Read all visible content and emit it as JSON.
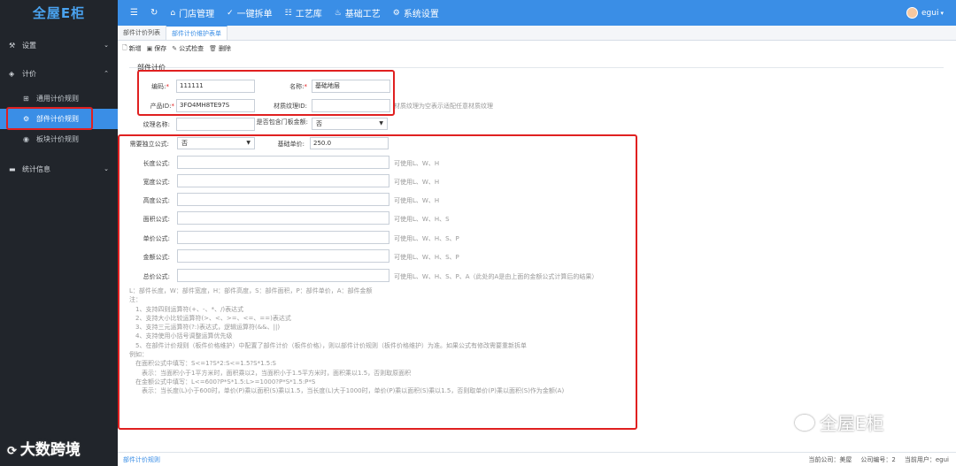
{
  "app": {
    "logo": "全屋E柜"
  },
  "sidebar": {
    "groups": [
      {
        "label": "设置",
        "icon": "settings-icon"
      },
      {
        "label": "计价",
        "icon": "diamond-icon"
      },
      {
        "label": "统计信息",
        "icon": "chart-icon"
      }
    ],
    "sub_items": [
      {
        "label": "通用计价规则"
      },
      {
        "label": "部件计价规则"
      },
      {
        "label": "板块计价规则"
      }
    ]
  },
  "topbar": {
    "menu_icon": "☰",
    "refresh_icon": "↻",
    "items": [
      "门店管理",
      "一键拆单",
      "工艺库",
      "基础工艺",
      "系统设置"
    ],
    "user": "egui"
  },
  "tabs": [
    "部件计价列表",
    "部件计价维护表单"
  ],
  "toolbar": {
    "new": "新增",
    "save": "保存",
    "check": "公式检查",
    "delete": "删除"
  },
  "form": {
    "legend": "部件计价",
    "code_label": "编码:",
    "code_value": "111111",
    "name_label": "名称:",
    "name_value": "基础地层",
    "product_id_label": "产品ID:",
    "product_id_value": "3FO4MH8TE97S",
    "texture_id_label": "材质纹理ID:",
    "texture_id_value": "",
    "texture_hint": "材质纹理为空表示适配任意材质纹理",
    "texture_name_label": "纹理名称:",
    "texture_name_value": "",
    "door_label": "是否包含门板金额:",
    "door_value": "否",
    "independent_label": "需要独立公式:",
    "independent_value": "否",
    "base_price_label": "基础单价:",
    "base_price_value": "250.0",
    "formulas": [
      {
        "label": "长度公式:",
        "hint": "可使用L、W、H"
      },
      {
        "label": "宽度公式:",
        "hint": "可使用L、W、H"
      },
      {
        "label": "高度公式:",
        "hint": "可使用L、W、H"
      },
      {
        "label": "面积公式:",
        "hint": "可使用L、W、H、S"
      },
      {
        "label": "单价公式:",
        "hint": "可使用L、W、H、S、P"
      },
      {
        "label": "金额公式:",
        "hint": "可使用L、W、H、S、P"
      },
      {
        "label": "总价公式:",
        "hint": "可使用L、W、H、S、P、A（此处的A是由上面的金额公式计算后的结果）"
      }
    ]
  },
  "notes": [
    "L：部件长度，W：部件宽度，H：部件高度，S：部件面积，P：部件单价，A：部件金额",
    "注：",
    "　1、支持四则运算符(+、-、*、/)表达式",
    "　2、支持大小比较运算符(>、<、>=、<=、==)表达式",
    "　3、支持三元运算符(?:)表达式，逻辑运算符(&&、||)",
    "　4、支持使用小括号调整运算优先级",
    "　5、在部件计价规则（板件价格维护）中配置了部件计价（板件价格），则以部件计价规则（板件价格维护）为准。如果公式有修改需要重新拆单",
    "例如：",
    "　在面积公式中填写：S<=1?S*2:S<=1.5?S*1.5:S",
    "　　表示：当面积小于1平方米时，面积乘以2，当面积小于1.5平方米时，面积乘以1.5，否则取原面积",
    "　在金额公式中填写：L<=600?P*S*1.5:L>=1000?P*S*1.5:P*S",
    "　　表示：当长度(L)小于600时，单价(P)乘以面积(S)乘以1.5，当长度(L)大于1000时，单价(P)乘以面积(S)乘以1.5，否则取单价(P)乘以面积(S)作为金额(A)"
  ],
  "watermarks": {
    "left": "大数跨境",
    "right": "全屋E柜"
  },
  "footer": {
    "crumb": "部件计价规则",
    "company": "当前公司：美屋",
    "company_no": "公司编号：2",
    "current_user": "当前用户：egui"
  }
}
